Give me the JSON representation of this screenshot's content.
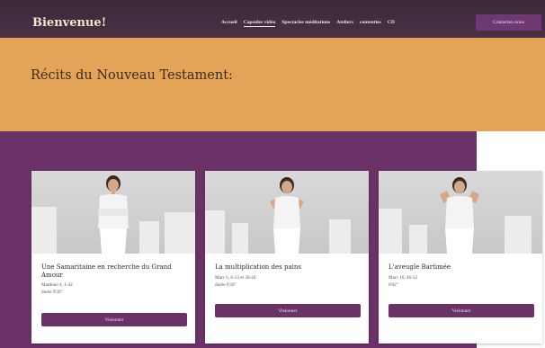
{
  "navbar": {
    "brand": "Bienvenue!",
    "links": [
      "Accueil",
      "Capsules vidéo",
      "Spectacles méditations",
      "Ateliers",
      "contenties",
      "CD"
    ],
    "active_link": "Capsules vidéo",
    "contact_label": "Contactez-nous"
  },
  "hero": {
    "title": "Récits du Nouveau Testament:"
  },
  "cards": [
    {
      "title": "Une Samaritaine en recherche du Grand Amour",
      "reference": "Matthieu 4, 1-42",
      "duration": "durée 9'39\"",
      "button_label": "Visionner"
    },
    {
      "title": "La multiplication des pains",
      "reference": "Marc 6, 6-13 et 30-44",
      "duration": "durée 6'20\"",
      "button_label": "Visionner"
    },
    {
      "title": "L'aveugle Bartimée",
      "reference": "Marc 10, 46-52",
      "duration": "6'02\"",
      "button_label": "Visionner"
    }
  ],
  "colors": {
    "purple": "#6b3268",
    "orange": "#e4a458",
    "nav_dark": "#3b2a3a"
  }
}
